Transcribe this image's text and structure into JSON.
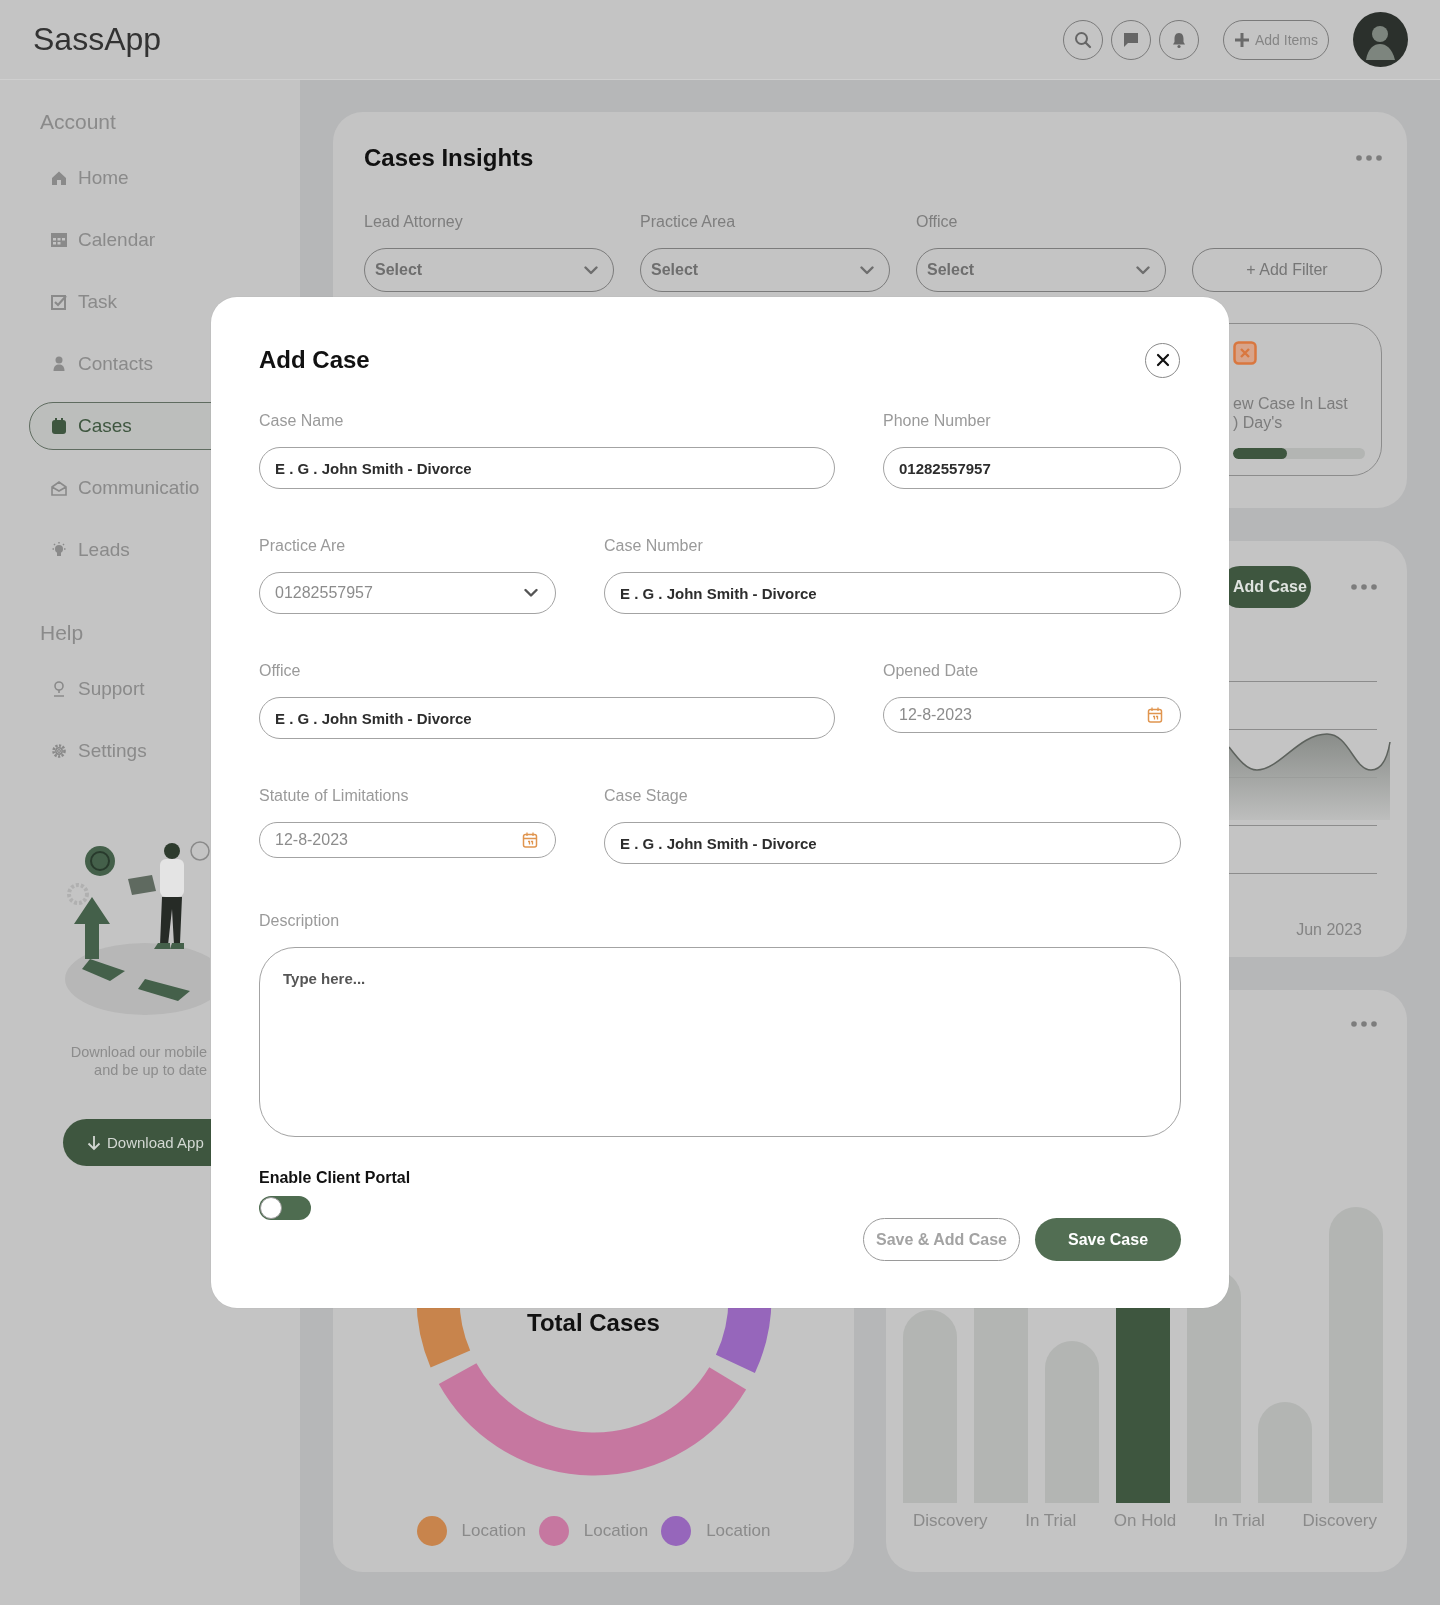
{
  "header": {
    "logo": "SassApp",
    "add_button": "Add Items"
  },
  "sidebar": {
    "sections": [
      {
        "heading": "Account",
        "items": [
          {
            "label": "Home",
            "selected": false
          },
          {
            "label": "Calendar",
            "selected": false
          },
          {
            "label": "Task",
            "selected": false
          },
          {
            "label": "Contacts",
            "selected": false
          },
          {
            "label": "Cases",
            "selected": true
          },
          {
            "label": "Communicatio",
            "selected": false
          },
          {
            "label": "Leads",
            "selected": false
          }
        ]
      },
      {
        "heading": "Help",
        "items": [
          {
            "label": "Support",
            "selected": false
          },
          {
            "label": "Settings",
            "selected": false
          }
        ]
      }
    ],
    "promo": {
      "lines": [
        "Download our mobile",
        "and be up to date"
      ],
      "button": "Download App"
    }
  },
  "insights": {
    "title": "Cases Insights",
    "filters": [
      {
        "label": "Lead Attorney",
        "placeholder": "Select"
      },
      {
        "label": "Practice Area",
        "placeholder": "Select"
      },
      {
        "label": "Office",
        "placeholder": "Select"
      }
    ],
    "add_filter": "+ Add Filter",
    "stat": {
      "lines": [
        "ew Case In Last",
        ") Day's"
      ],
      "level": 0.41
    }
  },
  "trend": {
    "button": "Add Case",
    "x_label": "Jun 2023"
  },
  "total_cases": {
    "title": "Total Cases",
    "legend": [
      {
        "label": "Location",
        "color": "#c8844c"
      },
      {
        "label": "Location",
        "color": "#c677a0"
      },
      {
        "label": "Location",
        "color": "#9666bb"
      }
    ]
  },
  "stages": {
    "bars": [
      {
        "selected": false
      },
      {
        "selected": false
      },
      {
        "selected": false
      },
      {
        "selected": true
      },
      {
        "selected": false
      },
      {
        "selected": false
      },
      {
        "selected": false
      }
    ],
    "labels": [
      "Discovery",
      "In Trial",
      "On Hold",
      "In Trial",
      "Discovery"
    ]
  },
  "modal": {
    "title": "Add Case",
    "rows": [
      [
        {
          "label": "Case Name",
          "kind": "text",
          "value": "E . G . John Smith - Divorce"
        },
        {
          "label": "Phone Number",
          "kind": "text",
          "value": "01282557957"
        }
      ],
      [
        {
          "label": "Practice Are",
          "kind": "select",
          "placeholder": "01282557957"
        },
        {
          "label": "Case Number",
          "kind": "text",
          "value": "E . G . John Smith - Divorce"
        }
      ],
      [
        {
          "label": "Office",
          "kind": "text",
          "value": "E . G . John Smith - Divorce"
        },
        {
          "label": "Opened Date",
          "kind": "date",
          "placeholder": "12-8-2023"
        }
      ],
      [
        {
          "label": "Statute of Limitations",
          "kind": "date",
          "placeholder": "12-8-2023"
        },
        {
          "label": "Case Stage",
          "kind": "text",
          "value": "E . G . John Smith - Divorce"
        }
      ]
    ],
    "description": {
      "label": "Description",
      "placeholder": "Type here..."
    },
    "client_portal": {
      "label": "Enable Client Portal",
      "on": false
    },
    "buttons": [
      {
        "label": "Save & Add Case",
        "kind": "secondary"
      },
      {
        "label": "Save Case",
        "kind": "primary"
      }
    ]
  }
}
